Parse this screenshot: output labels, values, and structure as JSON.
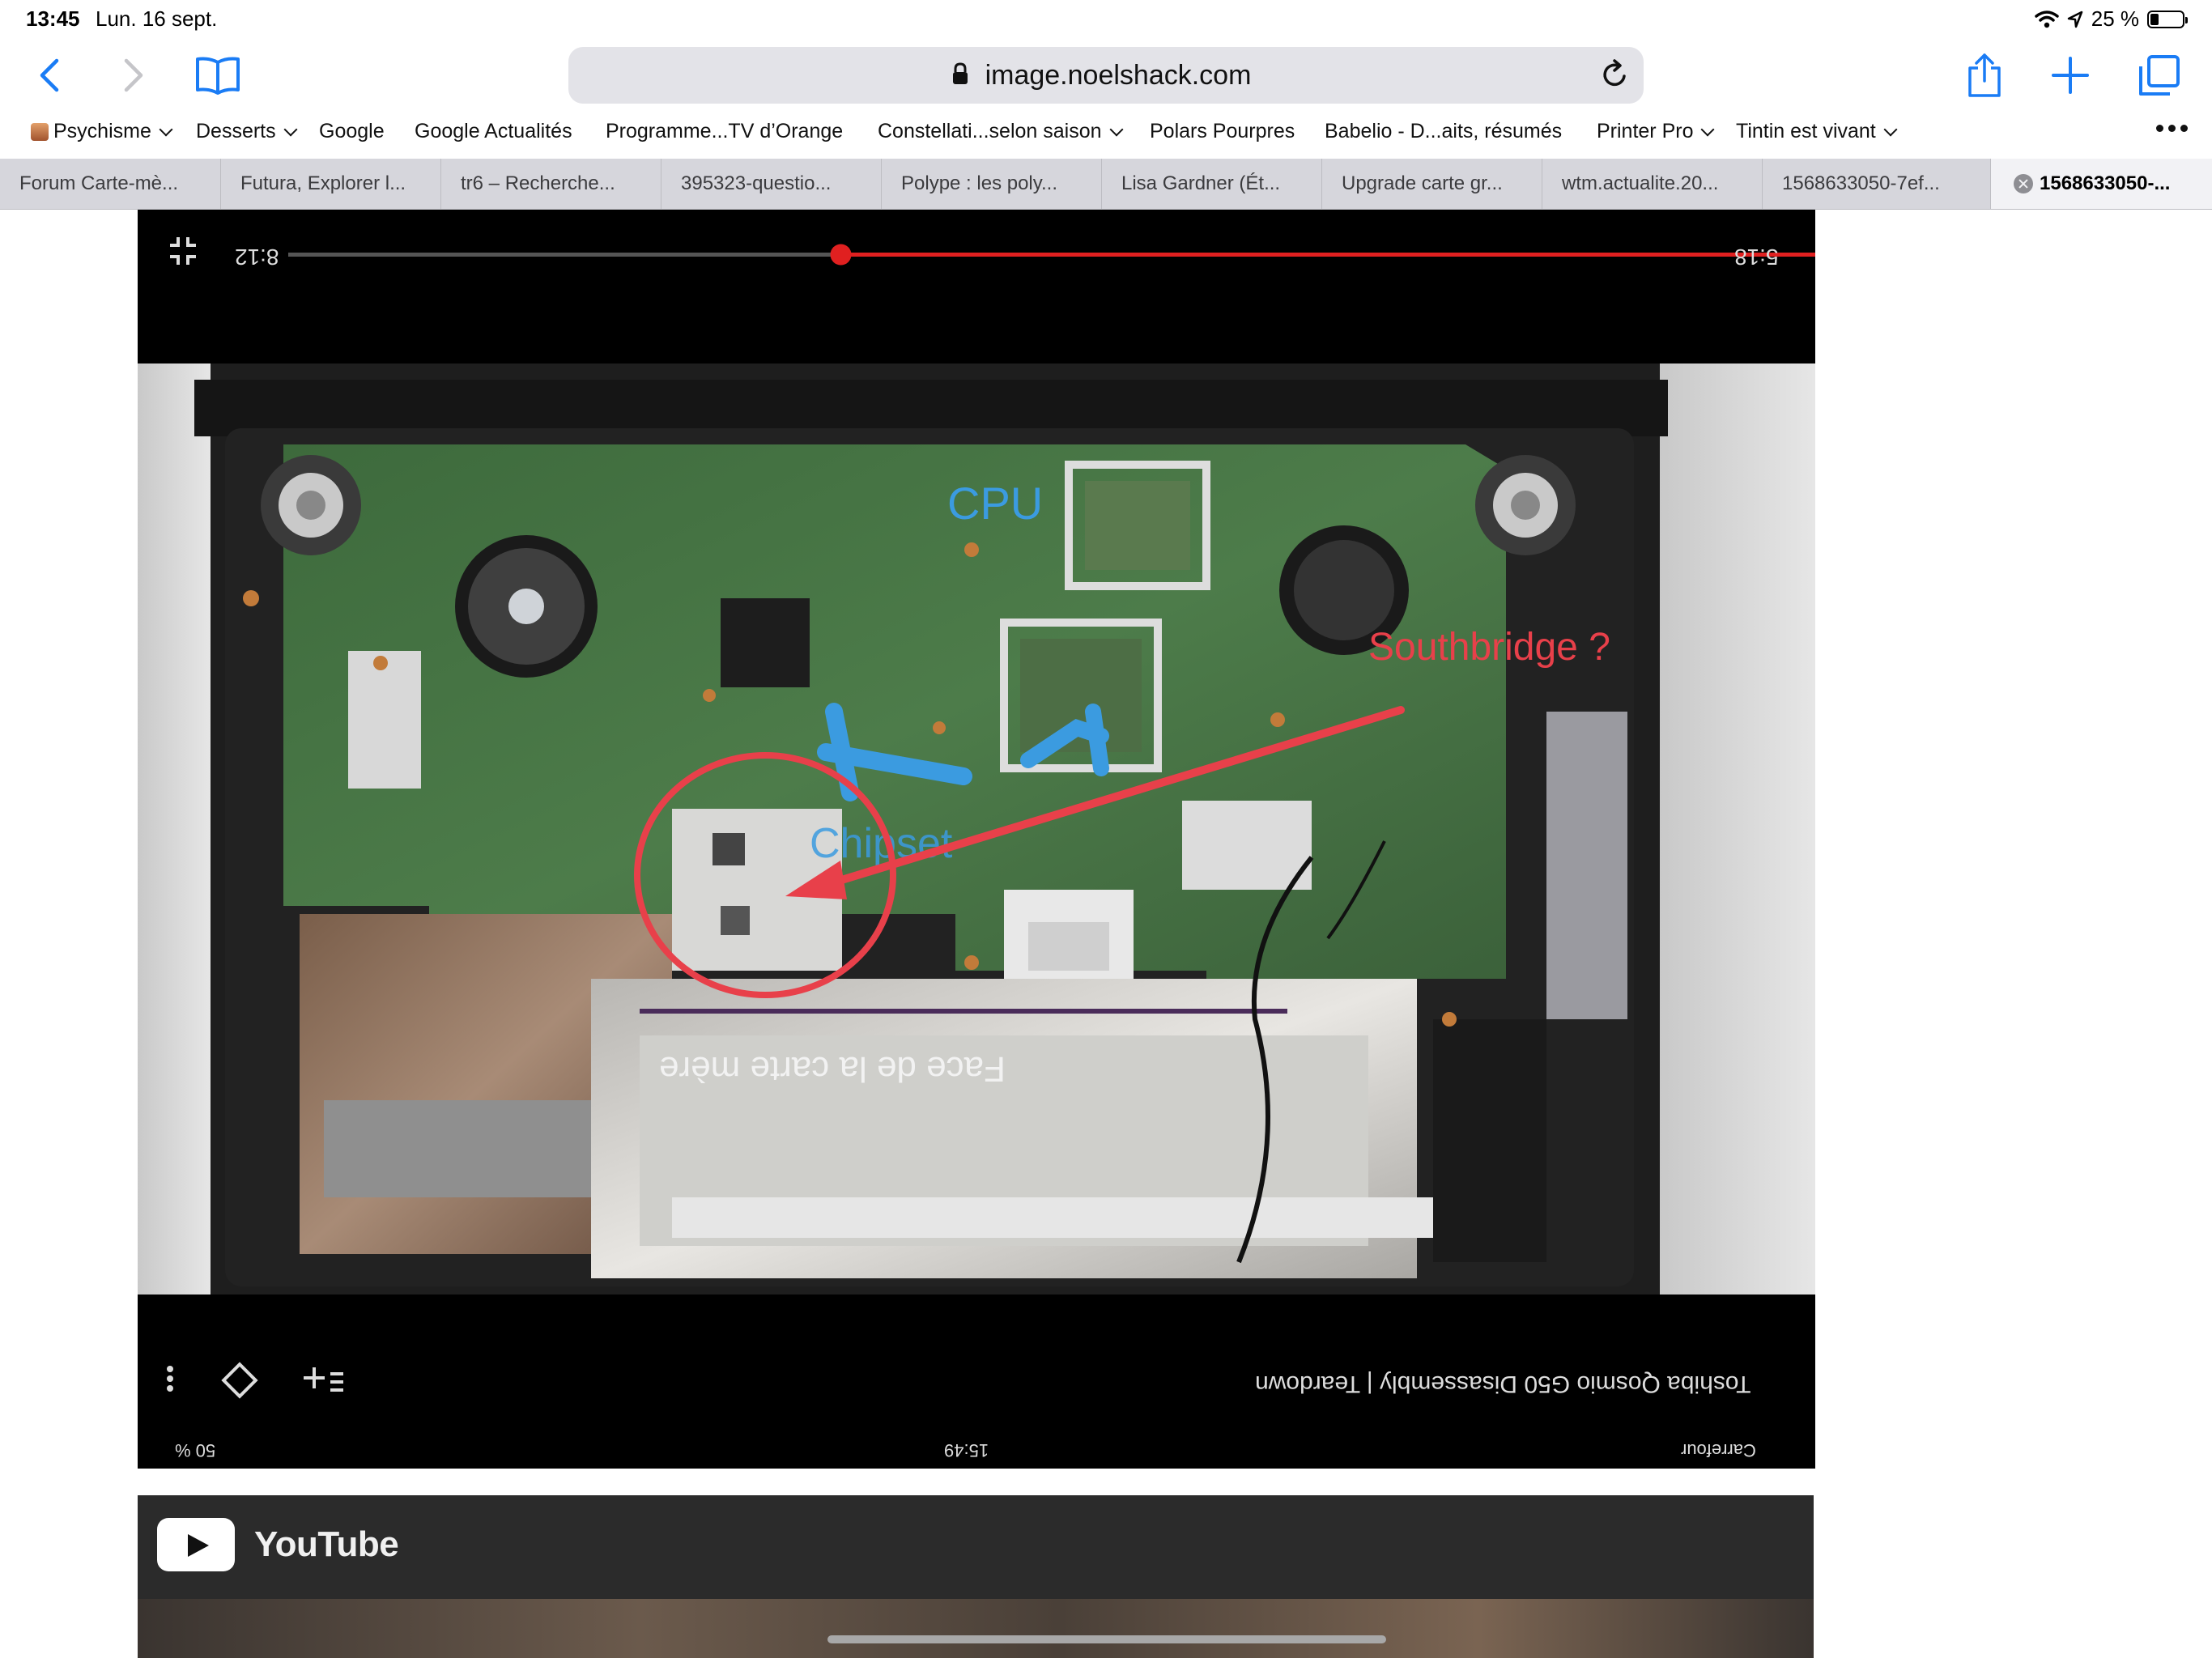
{
  "status": {
    "time": "13:45",
    "date": "Lun. 16 sept.",
    "battery_text": "25 %",
    "battery_level": 0.25
  },
  "toolbar": {
    "url": "image.noelshack.com"
  },
  "bookmarks": [
    {
      "label": "Psychisme",
      "folder": true
    },
    {
      "label": "Desserts",
      "folder": true
    },
    {
      "label": "Google",
      "folder": false
    },
    {
      "label": "Google Actualités",
      "folder": false
    },
    {
      "label": "Programme...TV d’Orange",
      "folder": false
    },
    {
      "label": "Constellati...selon saison",
      "folder": true
    },
    {
      "label": "Polars Pourpres",
      "folder": false
    },
    {
      "label": "Babelio - D...aits, résumés",
      "folder": false
    },
    {
      "label": "Printer Pro",
      "folder": true
    },
    {
      "label": "Tintin est vivant",
      "folder": true
    }
  ],
  "tabs": [
    {
      "label": "Forum Carte-mè...",
      "active": false
    },
    {
      "label": "Futura, Explorer l...",
      "active": false
    },
    {
      "label": "tr6 – Recherche...",
      "active": false
    },
    {
      "label": "395323-questio...",
      "active": false
    },
    {
      "label": "Polype : les poly...",
      "active": false
    },
    {
      "label": "Lisa Gardner (Ét...",
      "active": false
    },
    {
      "label": "Upgrade carte gr...",
      "active": false
    },
    {
      "label": "wtm.actualite.20...",
      "active": false
    },
    {
      "label": "1568633050-7ef...",
      "active": false
    },
    {
      "label": "1568633050-...",
      "active": true
    }
  ],
  "image": {
    "player_elapsed": "8:12",
    "player_duration": "5:18",
    "player_progress": 0.35,
    "label_cpu": "CPU",
    "label_chipset": "Chipset",
    "label_southbridge": "Southbridge ?",
    "label_face": "Face de la carte mère",
    "video_title": "Toshiba Qosmio G50 Disassembly | Teardown",
    "bottom_time": "15:49",
    "bottom_battery": "50 %",
    "bottom_carrier": "Carrefour",
    "colors": {
      "annotation_red": "#e8404a",
      "annotation_blue": "#3b9be0",
      "progress_red": "#e02020"
    }
  },
  "youtube": {
    "label": "YouTube"
  }
}
